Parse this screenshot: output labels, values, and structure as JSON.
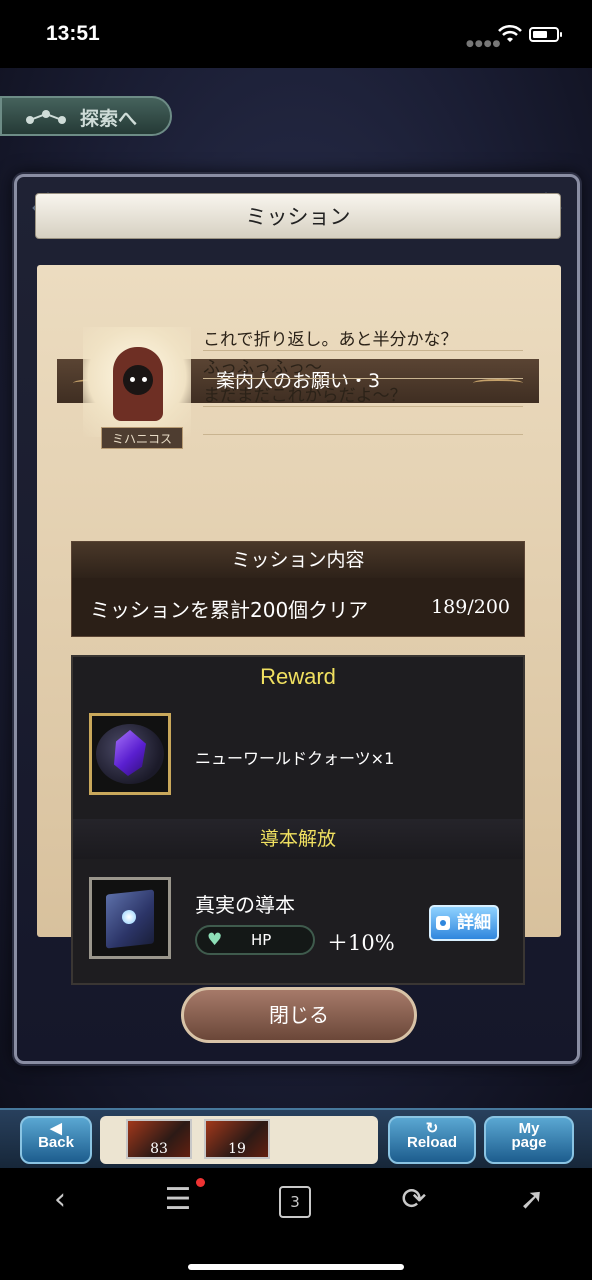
{
  "status_bar": {
    "time": "13:51"
  },
  "game": {
    "explore_button": "探索へ",
    "modal": {
      "title": "ミッション",
      "request_title": "案内人のお願い・3",
      "guide_name": "ミハニコス",
      "dialogue": [
        "これで折り返し。あと半分かな？",
        "ふっふっふっ～",
        "まだまだこれからだよ～？"
      ],
      "mission_header": "ミッション内容",
      "mission_text": "ミッションを累計200個クリア",
      "mission_progress": "189/200",
      "reward_header": "Reward",
      "reward_item": "ニューワールドクォーツ×1",
      "unlock_header": "導本解放",
      "book_name": "真実の導本",
      "stat_label": "HP",
      "stat_bonus": "＋10%",
      "detail_button": "詳細",
      "close_button": "閉じる"
    },
    "bottom_bar": {
      "back": [
        "Back"
      ],
      "thumbs": [
        "83",
        "19"
      ],
      "reload": "Reload",
      "mypage": [
        "My",
        "page"
      ]
    }
  },
  "browser_nav": {
    "tab_count": "3"
  }
}
